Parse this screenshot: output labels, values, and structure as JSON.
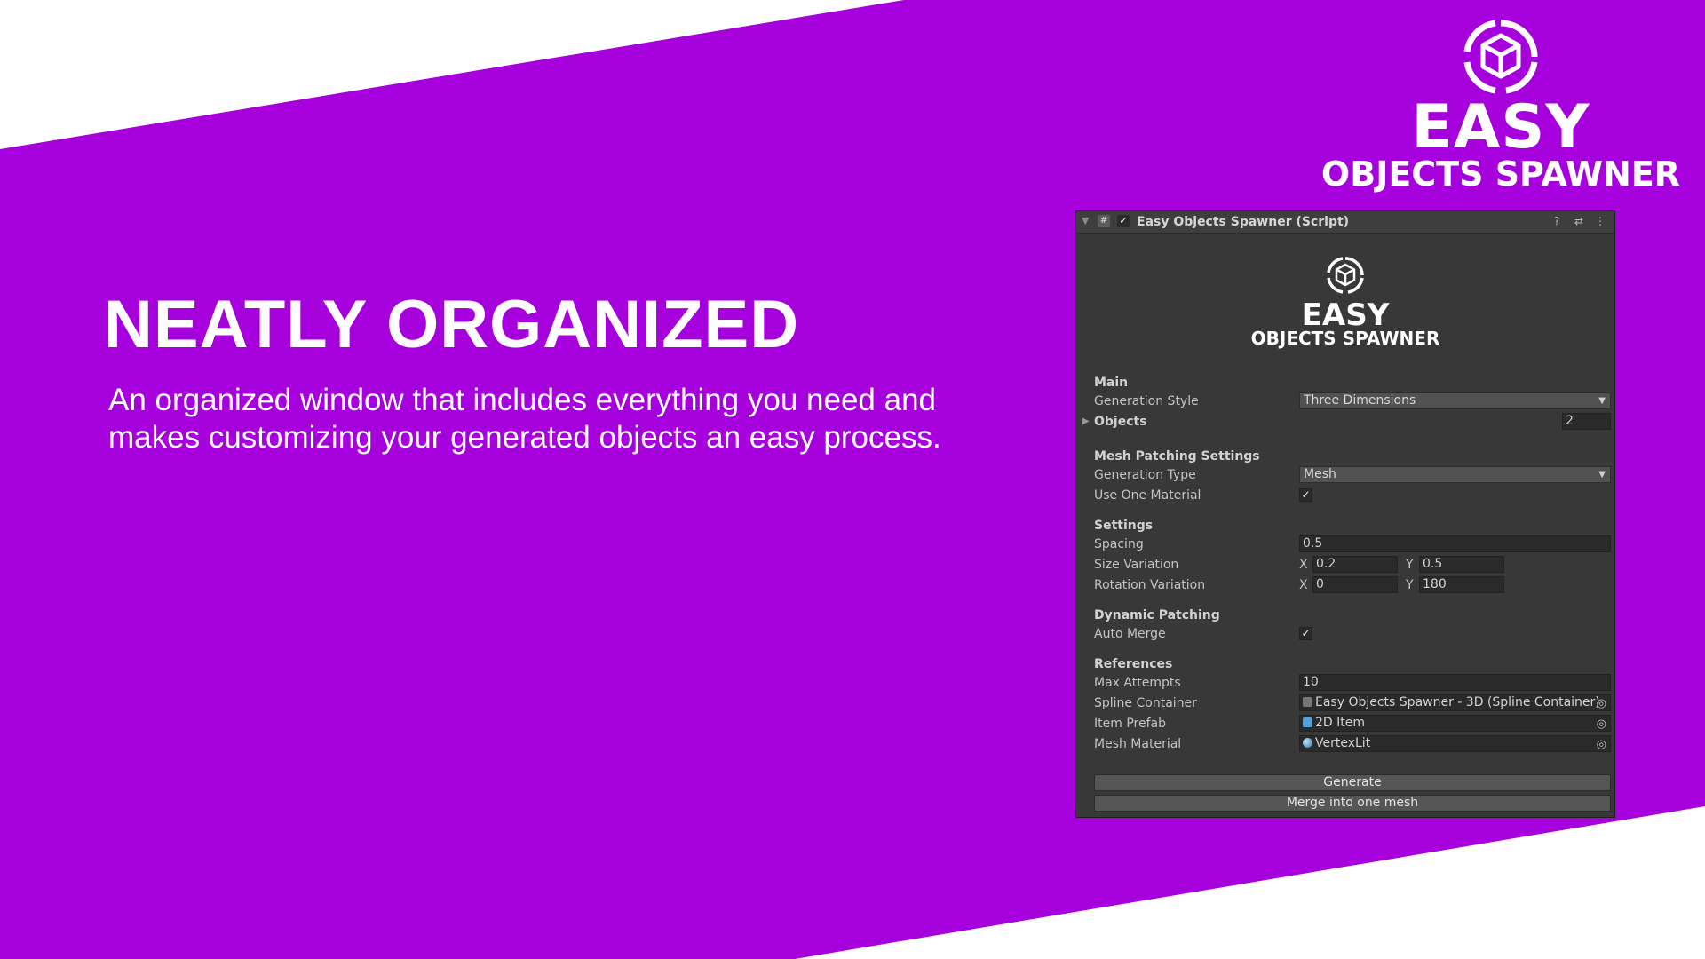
{
  "headline": "NEATLY ORGANIZED",
  "description": "An organized window that includes everything you need and makes customizing your generated objects an easy process.",
  "brand": {
    "line1": "EASY",
    "line2": "OBJECTS SPAWNER"
  },
  "colors": {
    "background_band": "#a600dd",
    "panel_bg": "#383838",
    "field_bg": "#2a2a2a"
  },
  "panel": {
    "title": "Easy Objects Spawner (Script)",
    "header_icons": [
      "collapse-arrow-icon",
      "script-icon",
      "checkbox-icon",
      "help-icon",
      "settings-icon",
      "more-icon"
    ],
    "logo": {
      "line1": "EASY",
      "line2": "OBJECTS SPAWNER"
    },
    "main": {
      "heading": "Main",
      "generation_style_label": "Generation Style",
      "generation_style_value": "Three Dimensions",
      "objects_label": "Objects",
      "objects_value": "2"
    },
    "mesh_patching": {
      "heading": "Mesh Patching Settings",
      "generation_type_label": "Generation Type",
      "generation_type_value": "Mesh",
      "use_one_material_label": "Use One Material",
      "use_one_material_checked": true
    },
    "settings": {
      "heading": "Settings",
      "spacing_label": "Spacing",
      "spacing_value": "0.5",
      "size_variation_label": "Size Variation",
      "size_variation_x_label": "X",
      "size_variation_x": "0.2",
      "size_variation_y_label": "Y",
      "size_variation_y": "0.5",
      "rotation_variation_label": "Rotation Variation",
      "rotation_variation_x_label": "X",
      "rotation_variation_x": "0",
      "rotation_variation_y_label": "Y",
      "rotation_variation_y": "180"
    },
    "dynamic_patching": {
      "heading": "Dynamic Patching",
      "auto_merge_label": "Auto Merge",
      "auto_merge_checked": true
    },
    "references": {
      "heading": "References",
      "max_attempts_label": "Max Attempts",
      "max_attempts_value": "10",
      "spline_container_label": "Spline Container",
      "spline_container_value": "Easy Objects Spawner - 3D (Spline Container)",
      "item_prefab_label": "Item Prefab",
      "item_prefab_value": "2D Item",
      "mesh_material_label": "Mesh Material",
      "mesh_material_value": "VertexLit"
    },
    "buttons": {
      "generate": "Generate",
      "merge": "Merge into one mesh"
    }
  }
}
